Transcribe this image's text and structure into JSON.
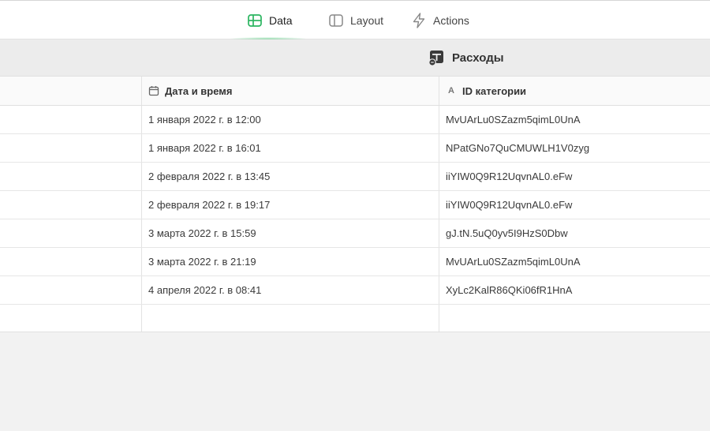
{
  "tabs": [
    {
      "label": "Data",
      "icon": "table-icon",
      "active": true,
      "accent": "#2bb560"
    },
    {
      "label": "Layout",
      "icon": "layout-icon",
      "active": false
    },
    {
      "label": "Actions",
      "icon": "bolt-icon",
      "active": false
    }
  ],
  "table": {
    "title": "Расходы",
    "icon": "table-settings-icon",
    "columns": [
      {
        "label": "",
        "type": ""
      },
      {
        "label": "Дата и время",
        "type": "calendar-icon"
      },
      {
        "label": "ID категории",
        "type": "A"
      }
    ],
    "rows": [
      {
        "datetime": "1 января 2022 г. в 12:00",
        "category_id": "MvUArLu0SZazm5qimL0UnA"
      },
      {
        "datetime": "1 января 2022 г. в 16:01",
        "category_id": "NPatGNo7QuCMUWLH1V0zyg"
      },
      {
        "datetime": "2 февраля 2022 г. в 13:45",
        "category_id": "iiYIW0Q9R12UqvnAL0.eFw"
      },
      {
        "datetime": "2 февраля 2022 г. в 19:17",
        "category_id": "iiYIW0Q9R12UqvnAL0.eFw"
      },
      {
        "datetime": "3 марта 2022 г. в 15:59",
        "category_id": "gJ.tN.5uQ0yv5I9HzS0Dbw"
      },
      {
        "datetime": "3 марта 2022 г. в 21:19",
        "category_id": "MvUArLu0SZazm5qimL0UnA"
      },
      {
        "datetime": "4 апреля 2022 г. в 08:41",
        "category_id": "XyLc2KalR86QKi06fR1HnA"
      }
    ]
  }
}
